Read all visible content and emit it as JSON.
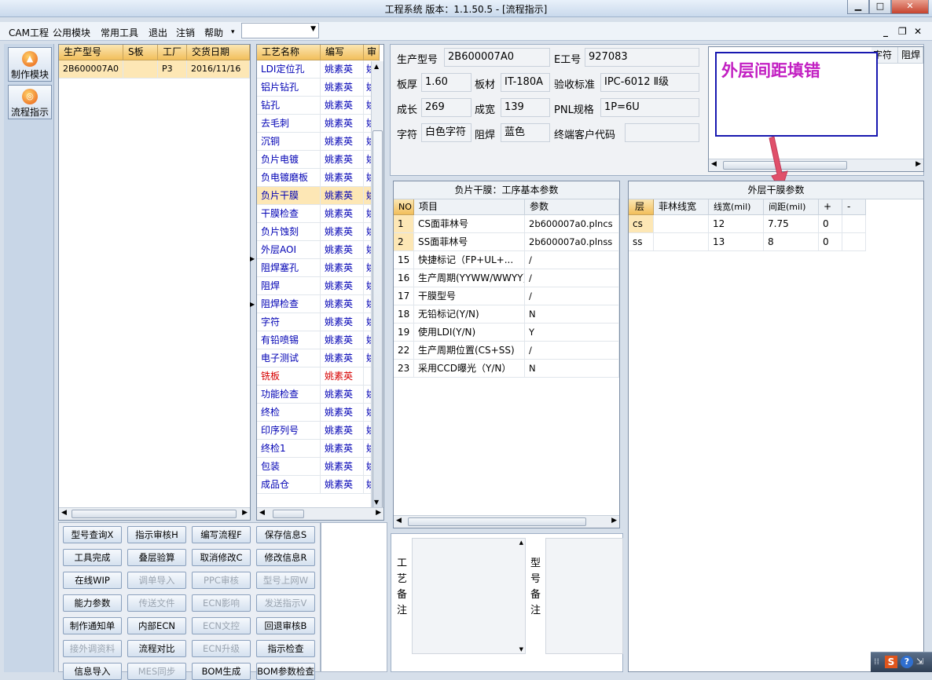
{
  "window": {
    "title": "工程系统   版本：1.1.50.5 - [流程指示]"
  },
  "menu": {
    "items": [
      "CAM工程",
      "公用模块",
      "常用工具",
      "退出",
      "注销",
      "帮助"
    ]
  },
  "sidebar": {
    "items": [
      {
        "label": "制作模块"
      },
      {
        "label": "流程指示"
      }
    ]
  },
  "orders": {
    "columns": [
      "生产型号",
      "S板",
      "工厂",
      "交货日期"
    ],
    "rows": [
      [
        "2B600007A0",
        "",
        "P3",
        "2016/11/16"
      ]
    ]
  },
  "process": {
    "columns": [
      "工艺名称",
      "编写",
      "审"
    ],
    "rows": [
      {
        "name": "LDI定位孔",
        "author": "姚素英",
        "tail": "姚"
      },
      {
        "name": "铝片钻孔",
        "author": "姚素英",
        "tail": "姚"
      },
      {
        "name": "钻孔",
        "author": "姚素英",
        "tail": "姚"
      },
      {
        "name": "去毛刺",
        "author": "姚素英",
        "tail": "姚"
      },
      {
        "name": "沉铜",
        "author": "姚素英",
        "tail": "姚"
      },
      {
        "name": "负片电镀",
        "author": "姚素英",
        "tail": "姚"
      },
      {
        "name": "负电镀磨板",
        "author": "姚素英",
        "tail": "姚"
      },
      {
        "name": "负片干膜",
        "author": "姚素英",
        "tail": "姚"
      },
      {
        "name": "干膜检查",
        "author": "姚素英",
        "tail": "姚"
      },
      {
        "name": "负片蚀刻",
        "author": "姚素英",
        "tail": "姚"
      },
      {
        "name": "外层AOI",
        "author": "姚素英",
        "tail": "姚"
      },
      {
        "name": "阻焊塞孔",
        "author": "姚素英",
        "tail": "姚"
      },
      {
        "name": "阻焊",
        "author": "姚素英",
        "tail": "姚"
      },
      {
        "name": "阻焊检查",
        "author": "姚素英",
        "tail": "姚"
      },
      {
        "name": "字符",
        "author": "姚素英",
        "tail": "姚"
      },
      {
        "name": "有铅喷锡",
        "author": "姚素英",
        "tail": "姚"
      },
      {
        "name": "电子测试",
        "author": "姚素英",
        "tail": "姚"
      },
      {
        "name": "铣板",
        "author": "姚素英",
        "tail": ""
      },
      {
        "name": "功能检查",
        "author": "姚素英",
        "tail": "姚"
      },
      {
        "name": "终检",
        "author": "姚素英",
        "tail": "姚"
      },
      {
        "name": "印序列号",
        "author": "姚素英",
        "tail": "姚"
      },
      {
        "name": "终检1",
        "author": "姚素英",
        "tail": "姚"
      },
      {
        "name": "包装",
        "author": "姚素英",
        "tail": "姚"
      },
      {
        "name": "成品仓",
        "author": "姚素英",
        "tail": "姚"
      }
    ]
  },
  "info": {
    "model_label": "生产型号",
    "model": "2B600007A0",
    "eno_label": "E工号",
    "eno": "927083",
    "thick_label": "板厚",
    "thick": "1.60",
    "mat_label": "板材",
    "mat": "IT-180A",
    "std_label": "验收标准",
    "std": "IPC-6012 Ⅱ级",
    "len_label": "成长",
    "len": "269",
    "wid_label": "成宽",
    "wid": "139",
    "pnl_label": "PNL规格",
    "pnl": "1P=6U",
    "char_label": "字符",
    "char": "白色字符",
    "mask_label": "阻焊",
    "mask": "蓝色",
    "cust_label": "终端客户代码",
    "cust": ""
  },
  "minigrid": {
    "columns": [
      "字符",
      "阻焊"
    ]
  },
  "annotation": {
    "text": "外层间距填错"
  },
  "params": {
    "title": "负片干膜：工序基本参数",
    "columns": [
      "NO",
      "项目",
      "参数"
    ],
    "rows": [
      [
        "1",
        "CS面菲林号",
        "2b600007a0.plncs"
      ],
      [
        "2",
        "SS面菲林号",
        "2b600007a0.plnss"
      ],
      [
        "15",
        "快捷标记（FP+UL+...",
        "/"
      ],
      [
        "16",
        "生产周期(YYWW/WWYY)",
        "/"
      ],
      [
        "17",
        "干膜型号",
        "/"
      ],
      [
        "18",
        "无铅标记(Y/N)",
        "N"
      ],
      [
        "19",
        "使用LDI(Y/N)",
        "Y"
      ],
      [
        "22",
        "生产周期位置(CS+SS)",
        "/"
      ],
      [
        "23",
        "采用CCD曝光（Y/N）",
        "N"
      ]
    ]
  },
  "outer": {
    "title": "外层干膜参数",
    "columns": [
      "层",
      "菲林线宽",
      "线宽(mil)",
      "间距(mil)",
      "+",
      "-"
    ],
    "rows": [
      [
        "cs",
        "",
        "12",
        "7.75",
        "0",
        ""
      ],
      [
        "ss",
        "",
        "13",
        "8",
        "0",
        ""
      ]
    ]
  },
  "remarks": {
    "process_label": "工艺备注",
    "model_label": "型号备注"
  },
  "buttons": [
    [
      {
        "label": "型号查询X",
        "enabled": true
      },
      {
        "label": "指示审核H",
        "enabled": true
      },
      {
        "label": "编写流程F",
        "enabled": true
      },
      {
        "label": "保存信息S",
        "enabled": true
      }
    ],
    [
      {
        "label": "工具完成",
        "enabled": true
      },
      {
        "label": "叠层验算",
        "enabled": true
      },
      {
        "label": "取消修改C",
        "enabled": true
      },
      {
        "label": "修改信息R",
        "enabled": true
      }
    ],
    [
      {
        "label": "在线WIP",
        "enabled": true
      },
      {
        "label": "调单导入",
        "enabled": false
      },
      {
        "label": "PPC审核",
        "enabled": false
      },
      {
        "label": "型号上网W",
        "enabled": false
      }
    ],
    [
      {
        "label": "能力参数",
        "enabled": true
      },
      {
        "label": "传送文件",
        "enabled": false
      },
      {
        "label": "ECN影响",
        "enabled": false
      },
      {
        "label": "发送指示V",
        "enabled": false
      }
    ],
    [
      {
        "label": "制作通知单",
        "enabled": true
      },
      {
        "label": "内部ECN",
        "enabled": true
      },
      {
        "label": "ECN文控",
        "enabled": false
      },
      {
        "label": "回退审核B",
        "enabled": true
      }
    ],
    [
      {
        "label": "接外调资料",
        "enabled": false
      },
      {
        "label": "流程对比",
        "enabled": true
      },
      {
        "label": "ECN升级",
        "enabled": false
      },
      {
        "label": "指示检查",
        "enabled": true
      }
    ],
    [
      {
        "label": "信息导入",
        "enabled": true
      },
      {
        "label": "MES同步",
        "enabled": false
      },
      {
        "label": "BOM生成",
        "enabled": true
      },
      {
        "label": "BOM参数检查",
        "enabled": true
      }
    ]
  ]
}
